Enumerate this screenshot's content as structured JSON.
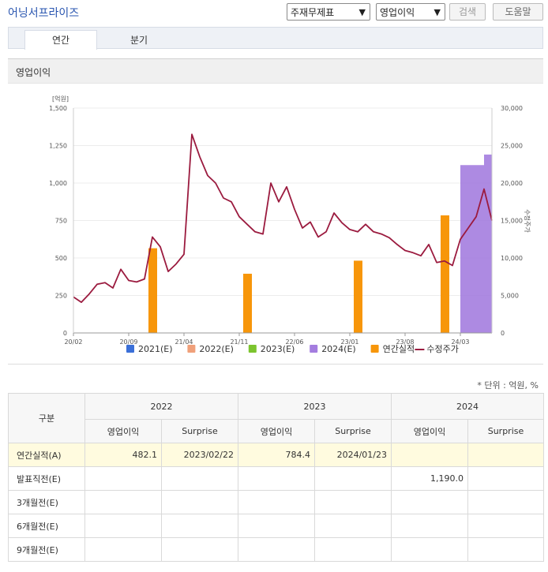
{
  "header": {
    "company": "어닝서프라이즈",
    "select1": "주재무제표",
    "select2": "영업이익",
    "search_btn": "검색",
    "help_btn": "도움말"
  },
  "tabs": [
    {
      "label": "연간"
    },
    {
      "label": "분기"
    }
  ],
  "section_title": "영업이익",
  "chart_data": {
    "type": "bar+line",
    "y_left_unit": "[억원]",
    "y_left_ticks": [
      "1,500",
      "1,250",
      "1,000",
      "750",
      "500",
      "250",
      "0"
    ],
    "y_left_range": [
      0,
      1500
    ],
    "y_right_ticks": [
      "30,000",
      "25,000",
      "20,000",
      "15,000",
      "10,000",
      "5,000",
      "0"
    ],
    "y_right_range": [
      0,
      30000
    ],
    "y_right_label": "수정주가",
    "x_range": [
      "2020-02",
      "2024-07"
    ],
    "x_ticks": [
      "20/02",
      "20/09",
      "21/04",
      "21/11",
      "22/06",
      "23/01",
      "23/08",
      "24/03"
    ],
    "legend": [
      {
        "name": "2021(E)",
        "color": "#3a6fd8",
        "shape": "square"
      },
      {
        "name": "2022(E)",
        "color": "#f0a07a",
        "shape": "square"
      },
      {
        "name": "2023(E)",
        "color": "#7cc42e",
        "shape": "square"
      },
      {
        "name": "2024(E)",
        "color": "#a47ddf",
        "shape": "square"
      },
      {
        "name": "연간실적",
        "color": "#f7960a",
        "shape": "square"
      },
      {
        "name": "수정주가",
        "color": "#9b1b3f",
        "shape": "line"
      }
    ],
    "annual_bars": [
      {
        "date": "2020-12",
        "value": 565
      },
      {
        "date": "2021-12",
        "value": 395
      },
      {
        "date": "2023-02",
        "value": 482.1
      },
      {
        "date": "2024-01",
        "value": 784.4
      }
    ],
    "estimate_2024": {
      "color": "#a47ddf",
      "points": [
        {
          "date": "2024-03",
          "value": 1120
        },
        {
          "date": "2024-05",
          "value": 1120
        },
        {
          "date": "2024-06",
          "value": 1190
        },
        {
          "date": "2024-07",
          "value": 1190
        }
      ]
    },
    "price": [
      {
        "date": "2020-02",
        "value": 4800
      },
      {
        "date": "2020-03",
        "value": 4100
      },
      {
        "date": "2020-04",
        "value": 5200
      },
      {
        "date": "2020-05",
        "value": 6500
      },
      {
        "date": "2020-06",
        "value": 6700
      },
      {
        "date": "2020-07",
        "value": 6000
      },
      {
        "date": "2020-08",
        "value": 8500
      },
      {
        "date": "2020-09",
        "value": 7000
      },
      {
        "date": "2020-10",
        "value": 6800
      },
      {
        "date": "2020-11",
        "value": 7200
      },
      {
        "date": "2020-12",
        "value": 12800
      },
      {
        "date": "2021-01",
        "value": 11500
      },
      {
        "date": "2021-02",
        "value": 8200
      },
      {
        "date": "2021-03",
        "value": 9200
      },
      {
        "date": "2021-04",
        "value": 10500
      },
      {
        "date": "2021-05",
        "value": 26500
      },
      {
        "date": "2021-06",
        "value": 23500
      },
      {
        "date": "2021-07",
        "value": 21000
      },
      {
        "date": "2021-08",
        "value": 20000
      },
      {
        "date": "2021-09",
        "value": 18000
      },
      {
        "date": "2021-10",
        "value": 17500
      },
      {
        "date": "2021-11",
        "value": 15500
      },
      {
        "date": "2021-12",
        "value": 14500
      },
      {
        "date": "2022-01",
        "value": 13500
      },
      {
        "date": "2022-02",
        "value": 13200
      },
      {
        "date": "2022-03",
        "value": 20000
      },
      {
        "date": "2022-04",
        "value": 17500
      },
      {
        "date": "2022-05",
        "value": 19500
      },
      {
        "date": "2022-06",
        "value": 16500
      },
      {
        "date": "2022-07",
        "value": 14000
      },
      {
        "date": "2022-08",
        "value": 14800
      },
      {
        "date": "2022-09",
        "value": 12800
      },
      {
        "date": "2022-10",
        "value": 13500
      },
      {
        "date": "2022-11",
        "value": 16000
      },
      {
        "date": "2022-12",
        "value": 14700
      },
      {
        "date": "2023-01",
        "value": 13800
      },
      {
        "date": "2023-02",
        "value": 13500
      },
      {
        "date": "2023-03",
        "value": 14500
      },
      {
        "date": "2023-04",
        "value": 13500
      },
      {
        "date": "2023-05",
        "value": 13200
      },
      {
        "date": "2023-06",
        "value": 12700
      },
      {
        "date": "2023-07",
        "value": 11800
      },
      {
        "date": "2023-08",
        "value": 11000
      },
      {
        "date": "2023-09",
        "value": 10700
      },
      {
        "date": "2023-10",
        "value": 10300
      },
      {
        "date": "2023-11",
        "value": 11800
      },
      {
        "date": "2023-12",
        "value": 9400
      },
      {
        "date": "2024-01",
        "value": 9600
      },
      {
        "date": "2024-02",
        "value": 9000
      },
      {
        "date": "2024-03",
        "value": 12500
      },
      {
        "date": "2024-04",
        "value": 14000
      },
      {
        "date": "2024-05",
        "value": 15500
      },
      {
        "date": "2024-06",
        "value": 19200
      },
      {
        "date": "2024-07",
        "value": 15000
      }
    ]
  },
  "unit_note": "* 단위 : 억원, %",
  "table": {
    "corner": "구분",
    "years": [
      "2022",
      "2023",
      "2024"
    ],
    "subheaders": [
      "영업이익",
      "Surprise",
      "영업이익",
      "Surprise",
      "영업이익",
      "Surprise"
    ],
    "rows": [
      {
        "label": "연간실적(A)",
        "cells": [
          "482.1",
          "2023/02/22",
          "784.4",
          "2024/01/23",
          "",
          ""
        ]
      },
      {
        "label": "발표직전(E)",
        "cells": [
          "",
          "",
          "",
          "",
          "1,190.0",
          ""
        ]
      },
      {
        "label": "3개월전(E)",
        "cells": [
          "",
          "",
          "",
          "",
          "",
          ""
        ]
      },
      {
        "label": "6개월전(E)",
        "cells": [
          "",
          "",
          "",
          "",
          "",
          ""
        ]
      },
      {
        "label": "9개월전(E)",
        "cells": [
          "",
          "",
          "",
          "",
          "",
          ""
        ]
      }
    ]
  }
}
